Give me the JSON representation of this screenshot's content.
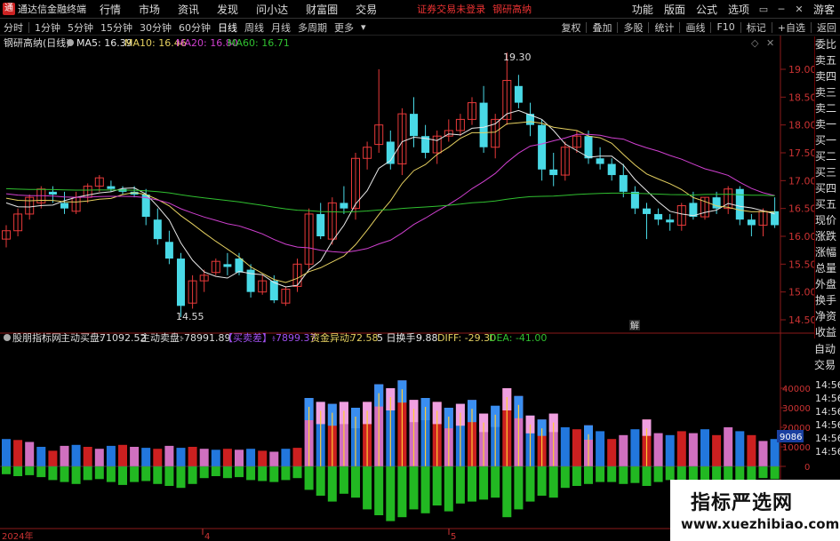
{
  "app": {
    "title": "通达信金融终端",
    "menus": [
      "行情",
      "市场",
      "资讯",
      "发现",
      "问小达",
      "财富圈",
      "交易"
    ],
    "login_status": "证券交易未登录",
    "stock_name": "钢研高纳",
    "right_menus": [
      "功能",
      "版面",
      "公式",
      "选项"
    ],
    "guest": "游客"
  },
  "toolbar": {
    "periods": [
      "分时",
      "1分钟",
      "5分钟",
      "15分钟",
      "30分钟",
      "60分钟",
      "日线",
      "周线",
      "月线",
      "多周期",
      "更多"
    ],
    "active_period": "日线",
    "right_buttons": [
      "复权",
      "叠加",
      "多股",
      "统计",
      "画线",
      "F10",
      "标记",
      "+自选",
      "返回"
    ]
  },
  "main_chart": {
    "title": "钢研高纳(日线)",
    "ma": [
      {
        "label": "MA5: 16.39",
        "color": "#e8e8e8"
      },
      {
        "label": "MA10: 16.46",
        "color": "#e5d060"
      },
      {
        "label": "MA20: 16.80",
        "color": "#d040d0"
      },
      {
        "label": "MA60: 16.71",
        "color": "#30c030"
      }
    ],
    "y_ticks": [
      "19.00",
      "18.50",
      "18.00",
      "17.50",
      "17.00",
      "16.50",
      "16.00",
      "15.50",
      "15.00",
      "14.50"
    ],
    "high_label": "19.30",
    "low_label": "14.55",
    "marker": "解"
  },
  "indicator": {
    "name": "股朋指标网",
    "buy_label": "主动买盘:",
    "buy_value": "71092.52",
    "sell_label": "主动卖盘:",
    "sell_value": "-78991.89",
    "diff_label": "【买卖差】:",
    "diff_value": "-7899.37",
    "fund_label": "资金异动:",
    "fund_value": "72.58",
    "turnover_label": "5 日换手:",
    "turnover_value": "9.88",
    "macd_diff": "DIFF: -29.30",
    "macd_dea": "DEA: -41.00",
    "y_ticks": [
      "40000",
      "30000",
      "20000",
      "10000",
      "0"
    ],
    "current_value": "9086"
  },
  "x_axis": {
    "labels": [
      "2024年",
      "4",
      "5"
    ]
  },
  "quote_panel": {
    "wb_label": "委比",
    "items": [
      "委比",
      "卖五",
      "卖四",
      "卖三",
      "卖二",
      "卖一",
      "买一",
      "买二",
      "买三",
      "买四",
      "买五",
      "现价",
      "涨跌",
      "涨幅",
      "总量",
      "外盘",
      "换手",
      "净资",
      "收益"
    ]
  },
  "trade_panel": {
    "items": [
      "自动",
      "交易"
    ]
  },
  "time_labels": [
    "14:56",
    "14:56",
    "14:56",
    "14:56",
    "14:56",
    "14:56"
  ],
  "watermark": {
    "title": "指标严选网",
    "url": "www.xuezhibiao.com"
  }
}
